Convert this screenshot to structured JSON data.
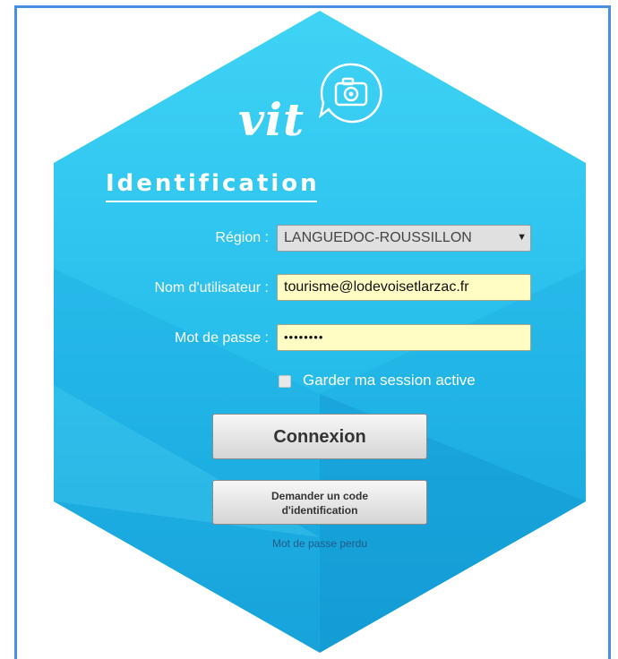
{
  "logo": {
    "text": "vit",
    "icon": "camera-bubble-icon"
  },
  "form": {
    "title": "Identification",
    "region_label": "Région :",
    "region_value": "LANGUEDOC-ROUSSILLON",
    "username_label": "Nom d'utilisateur :",
    "username_value": "tourisme@lodevoisetlarzac.fr",
    "password_label": "Mot de passe :",
    "password_value": "••••••••",
    "remember_label": "Garder ma session active",
    "remember_checked": false,
    "login_button": "Connexion",
    "request_code_button_line1": "Demander un code",
    "request_code_button_line2": "d'identification",
    "lost_password_link": "Mot de passe perdu"
  },
  "colors": {
    "hex_light": "#44d0f3",
    "hex_dark": "#17a7dc",
    "frame_border": "#4a90e2",
    "input_bg": "#fffdc4"
  }
}
